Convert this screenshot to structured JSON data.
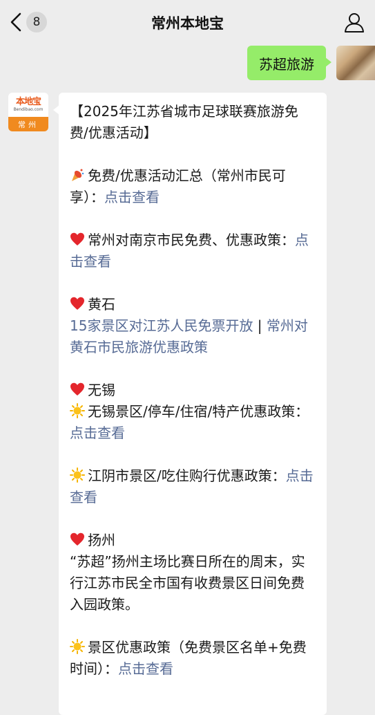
{
  "nav": {
    "unread_count": "8",
    "title": "常州本地宝"
  },
  "outgoing": {
    "text": "苏超旅游"
  },
  "avatar": {
    "logo_text": "本地宝",
    "logo_sub": "Bendibao.com",
    "city": "常州"
  },
  "message": {
    "heading": "【2025年江苏省城市足球联赛旅游免费/优惠活动】",
    "summary_text": "免费/优惠活动汇总（常州市民可享）：",
    "summary_link": "点击查看",
    "nanjing_text": "常州对南京市民免费、优惠政策：",
    "nanjing_link": "点击查看",
    "huangshi_title": "黄石",
    "huangshi_link1": "15家景区对江苏人民免票开放",
    "huangshi_sep": " | ",
    "huangshi_link2": "常州对黄石市民旅游优惠政策",
    "wuxi_title": "无锡",
    "wuxi_text": "无锡景区/停车/住宿/特产优惠政策：",
    "wuxi_link": "点击查看",
    "jiangyin_text": "江阴市景区/吃住购行优惠政策：",
    "jiangyin_link": "点击查看",
    "yangzhou_title": "扬州",
    "yangzhou_text": "“苏超”扬州主场比赛日所在的周末，实行江苏市民全市国有收费景区日间免费入园政策。",
    "scenic_text": "景区优惠政策（免费景区名单+免费时间）：",
    "scenic_link": "点击查看"
  },
  "colors": {
    "link": "#576b95",
    "outgoing_bubble": "#95ec69",
    "background": "#ededed"
  }
}
